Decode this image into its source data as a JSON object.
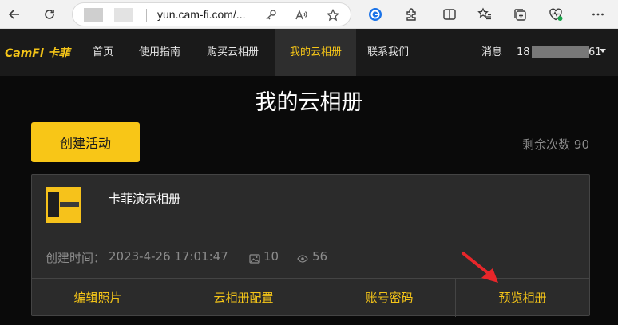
{
  "browser": {
    "url": "yun.cam-fi.com/..."
  },
  "nav": {
    "logo": "CamFi 卡菲",
    "items": [
      "首页",
      "使用指南",
      "购买云相册",
      "我的云相册",
      "联系我们"
    ],
    "messages": "消息",
    "phone_prefix": "18",
    "phone_suffix": "61"
  },
  "main": {
    "title": "我的云相册",
    "create_button": "创建活动",
    "remaining": "剩余次数 90"
  },
  "album": {
    "name": "卡菲演示相册",
    "created_label": "创建时间：",
    "created_at": "2023-4-26 17:01:47",
    "photos": "10",
    "views": "56",
    "actions": [
      "编辑照片",
      "云相册配置",
      "账号密码",
      "预览相册"
    ]
  },
  "colors": {
    "accent": "#f8c617",
    "annotation_arrow": "#e8262a"
  }
}
